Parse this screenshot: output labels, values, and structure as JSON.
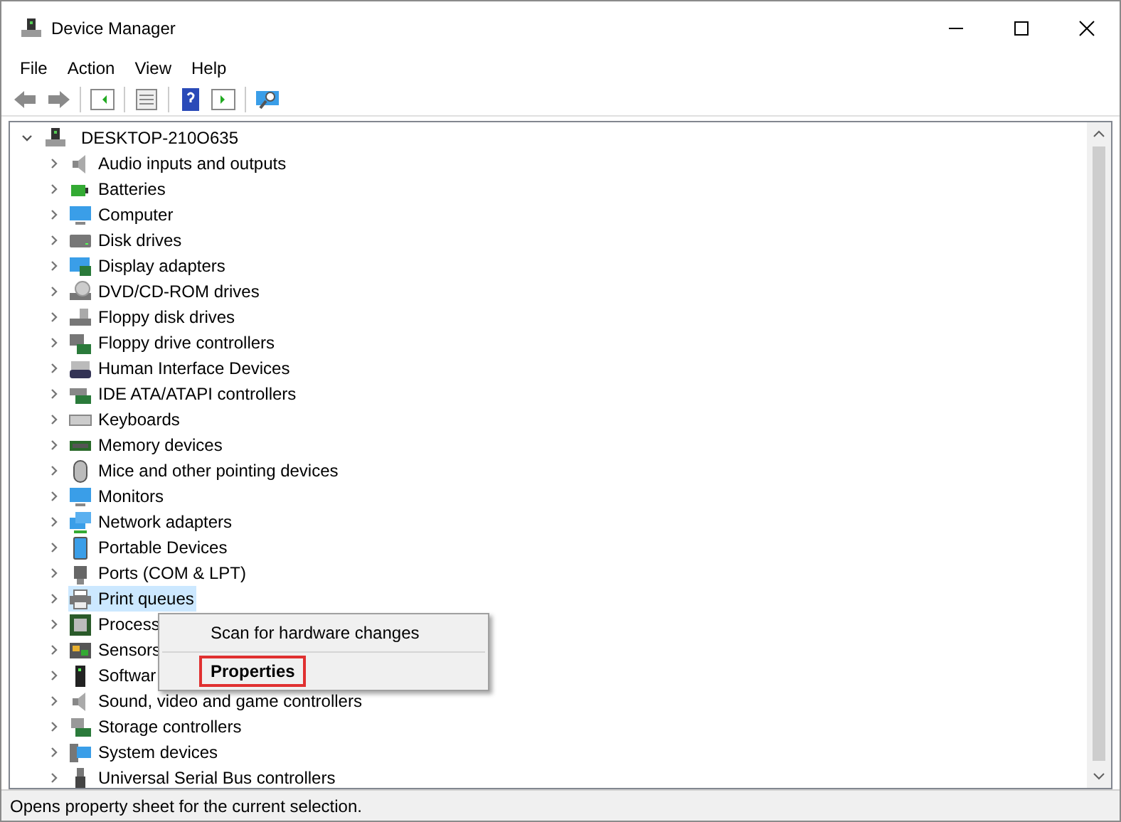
{
  "window": {
    "title": "Device Manager"
  },
  "menu": [
    "File",
    "Action",
    "View",
    "Help"
  ],
  "tree": {
    "label": "DESKTOP-210O635",
    "expanded": true,
    "children": [
      {
        "label": "Audio inputs and outputs",
        "selected": false
      },
      {
        "label": "Batteries",
        "selected": false
      },
      {
        "label": "Computer",
        "selected": false
      },
      {
        "label": "Disk drives",
        "selected": false
      },
      {
        "label": "Display adapters",
        "selected": false
      },
      {
        "label": "DVD/CD-ROM drives",
        "selected": false
      },
      {
        "label": "Floppy disk drives",
        "selected": false
      },
      {
        "label": "Floppy drive controllers",
        "selected": false
      },
      {
        "label": "Human Interface Devices",
        "selected": false
      },
      {
        "label": "IDE ATA/ATAPI controllers",
        "selected": false
      },
      {
        "label": "Keyboards",
        "selected": false
      },
      {
        "label": "Memory devices",
        "selected": false
      },
      {
        "label": "Mice and other pointing devices",
        "selected": false
      },
      {
        "label": "Monitors",
        "selected": false
      },
      {
        "label": "Network adapters",
        "selected": false
      },
      {
        "label": "Portable Devices",
        "selected": false
      },
      {
        "label": "Ports (COM & LPT)",
        "selected": false
      },
      {
        "label": "Print queues",
        "selected": true
      },
      {
        "label": "Process",
        "selected": false
      },
      {
        "label": "Sensors",
        "selected": false
      },
      {
        "label": "Softwar",
        "selected": false
      },
      {
        "label": "Sound, video and game controllers",
        "selected": false
      },
      {
        "label": "Storage controllers",
        "selected": false
      },
      {
        "label": "System devices",
        "selected": false
      },
      {
        "label": "Universal Serial Bus controllers",
        "selected": false
      }
    ]
  },
  "context_menu": [
    {
      "label": "Scan for hardware changes",
      "bold": false,
      "outlined": false
    },
    {
      "label": "Properties",
      "bold": true,
      "outlined": true
    }
  ],
  "status_bar": "Opens property sheet for the current selection."
}
